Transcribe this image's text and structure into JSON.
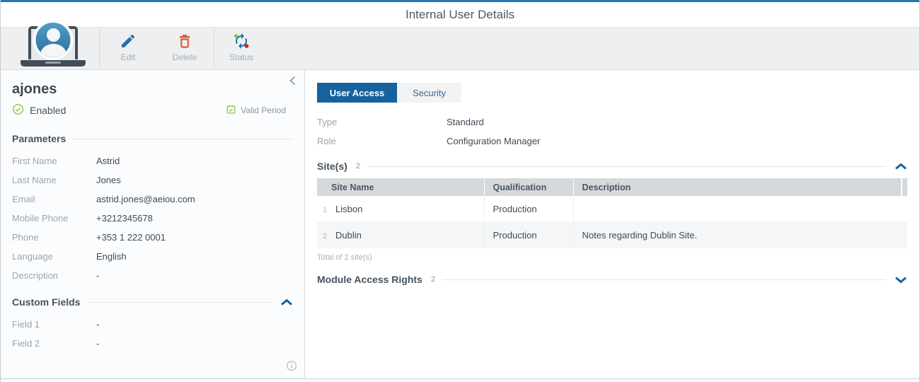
{
  "colors": {
    "top_bar": "#2677b5",
    "accent": "#15629f",
    "enabled_green": "#8bc34a",
    "edit_blue": "#2b6cb0",
    "delete_red": "#d9603f",
    "status_green": "#8dc63f",
    "status_red": "#c9252c",
    "text_dark": "#3e4a56",
    "text_label": "#9aa4ae",
    "table_header_bg": "#d5d9dc"
  },
  "header": {
    "title": "Internal User Details"
  },
  "toolbar": {
    "edit_label": "Edit",
    "delete_label": "Delete",
    "status_label": "Status"
  },
  "icons": {
    "user_photo": "laptop-with-user-avatar",
    "edit": "pencil-icon",
    "delete": "trash-icon",
    "status": "sync-arrows-icon",
    "enabled": "check-circle-icon",
    "valid_period": "calendar-check-icon",
    "panel_collapse": "chevron-left-icon",
    "section_collapse": "chevron-up-icon",
    "section_expand": "chevron-down-icon",
    "info": "info-circle-icon"
  },
  "user_panel": {
    "username": "ajones",
    "status_label": "Enabled",
    "valid_period_label": "Valid Period",
    "parameters": {
      "title": "Parameters",
      "fields": [
        {
          "label": "First Name",
          "value": "Astrid"
        },
        {
          "label": "Last Name",
          "value": "Jones"
        },
        {
          "label": "Email",
          "value": "astrid.jones@aeiou.com"
        },
        {
          "label": "Mobile Phone",
          "value": "+3212345678"
        },
        {
          "label": "Phone",
          "value": "+353 1 222 0001"
        },
        {
          "label": "Language",
          "value": "English"
        },
        {
          "label": "Description",
          "value": "-"
        }
      ]
    },
    "custom_fields": {
      "title": "Custom Fields",
      "fields": [
        {
          "label": "Field 1",
          "value": "-"
        },
        {
          "label": "Field 2",
          "value": "-"
        }
      ]
    }
  },
  "detail_panel": {
    "tabs": {
      "user_access": "User Access",
      "security": "Security"
    },
    "fields": [
      {
        "label": "Type",
        "value": "Standard"
      },
      {
        "label": "Role",
        "value": "Configuration Manager"
      }
    ],
    "sites": {
      "title": "Site(s)",
      "count": "2",
      "columns": [
        "Site Name",
        "Qualification",
        "Description"
      ],
      "rows": [
        {
          "num": "1",
          "site_name": "Lisbon",
          "qualification": "Production",
          "description": ""
        },
        {
          "num": "2",
          "site_name": "Dublin",
          "qualification": "Production",
          "description": "Notes regarding Dublin Site."
        }
      ],
      "footer": "Total of 2 site(s)"
    },
    "module_access": {
      "title": "Module Access Rights",
      "count": "2"
    }
  }
}
